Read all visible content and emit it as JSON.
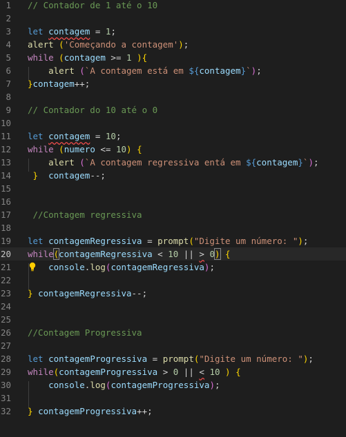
{
  "editor": {
    "current_line": 20,
    "lines": [
      {
        "n": "1",
        "tokens": [
          {
            "t": "// Contador de 1 até o 10",
            "c": "comment"
          }
        ]
      },
      {
        "n": "2",
        "tokens": []
      },
      {
        "n": "3",
        "tokens": [
          {
            "t": "let ",
            "c": "kw"
          },
          {
            "t": "contagem",
            "c": "var squig"
          },
          {
            "t": " = ",
            "c": "punc"
          },
          {
            "t": "1",
            "c": "num"
          },
          {
            "t": ";",
            "c": "punc"
          }
        ]
      },
      {
        "n": "4",
        "tokens": [
          {
            "t": "alert ",
            "c": "fn"
          },
          {
            "t": "(",
            "c": "br1"
          },
          {
            "t": "'Começando a contagem'",
            "c": "str"
          },
          {
            "t": ")",
            "c": "br1"
          },
          {
            "t": ";",
            "c": "punc"
          }
        ]
      },
      {
        "n": "5",
        "tokens": [
          {
            "t": "while ",
            "c": "ctrl"
          },
          {
            "t": "(",
            "c": "br1"
          },
          {
            "t": "contagem",
            "c": "var"
          },
          {
            "t": " >= ",
            "c": "punc"
          },
          {
            "t": "1 ",
            "c": "num"
          },
          {
            "t": ")",
            "c": "br1"
          },
          {
            "t": "{",
            "c": "br1"
          }
        ]
      },
      {
        "n": "6",
        "tokens": [
          {
            "t": "    alert ",
            "c": "fn"
          },
          {
            "t": "(",
            "c": "br2"
          },
          {
            "t": "`A contagem está em ",
            "c": "str"
          },
          {
            "t": "${",
            "c": "tpl"
          },
          {
            "t": "contagem",
            "c": "var"
          },
          {
            "t": "}",
            "c": "tpl"
          },
          {
            "t": "`",
            "c": "str"
          },
          {
            "t": ")",
            "c": "br2"
          },
          {
            "t": ";",
            "c": "punc"
          }
        ]
      },
      {
        "n": "7",
        "tokens": [
          {
            "t": "}",
            "c": "br1"
          },
          {
            "t": "contagem",
            "c": "var"
          },
          {
            "t": "++;",
            "c": "punc"
          }
        ]
      },
      {
        "n": "8",
        "tokens": []
      },
      {
        "n": "9",
        "tokens": [
          {
            "t": "// Contador do 10 até o 0",
            "c": "comment"
          }
        ]
      },
      {
        "n": "10",
        "tokens": []
      },
      {
        "n": "11",
        "tokens": [
          {
            "t": "let ",
            "c": "kw"
          },
          {
            "t": "contagem",
            "c": "var squig"
          },
          {
            "t": " = ",
            "c": "punc"
          },
          {
            "t": "10",
            "c": "num"
          },
          {
            "t": ";",
            "c": "punc"
          }
        ]
      },
      {
        "n": "12",
        "tokens": [
          {
            "t": "while ",
            "c": "ctrl"
          },
          {
            "t": "(",
            "c": "br1"
          },
          {
            "t": "numero",
            "c": "var"
          },
          {
            "t": " <= ",
            "c": "punc"
          },
          {
            "t": "10",
            "c": "num"
          },
          {
            "t": ") ",
            "c": "br1"
          },
          {
            "t": "{",
            "c": "br1"
          }
        ]
      },
      {
        "n": "13",
        "tokens": [
          {
            "t": "    alert ",
            "c": "fn"
          },
          {
            "t": "(",
            "c": "br2"
          },
          {
            "t": "`A contagem regressiva entá em ",
            "c": "str"
          },
          {
            "t": "${",
            "c": "tpl"
          },
          {
            "t": "contagem",
            "c": "var"
          },
          {
            "t": "}",
            "c": "tpl"
          },
          {
            "t": "`",
            "c": "str"
          },
          {
            "t": ")",
            "c": "br2"
          },
          {
            "t": ";",
            "c": "punc"
          }
        ]
      },
      {
        "n": "14",
        "tokens": [
          {
            "t": " }",
            "c": "br1"
          },
          {
            "t": "  contagem",
            "c": "var"
          },
          {
            "t": "--;",
            "c": "punc"
          }
        ]
      },
      {
        "n": "15",
        "tokens": []
      },
      {
        "n": "16",
        "tokens": []
      },
      {
        "n": "17",
        "tokens": [
          {
            "t": " //Contagem regressiva",
            "c": "comment"
          }
        ]
      },
      {
        "n": "18",
        "tokens": []
      },
      {
        "n": "19",
        "tokens": [
          {
            "t": "let ",
            "c": "kw"
          },
          {
            "t": "contagemRegressiva",
            "c": "var"
          },
          {
            "t": " = ",
            "c": "punc"
          },
          {
            "t": "prompt",
            "c": "fn"
          },
          {
            "t": "(",
            "c": "br1"
          },
          {
            "t": "\"Digite um número: \"",
            "c": "str"
          },
          {
            "t": ")",
            "c": "br1"
          },
          {
            "t": ";",
            "c": "punc"
          }
        ]
      },
      {
        "n": "20",
        "tokens": [
          {
            "t": "while",
            "c": "ctrl"
          },
          {
            "t": "(",
            "c": "br1 bracket-box"
          },
          {
            "t": "contagemRegressiva",
            "c": "var"
          },
          {
            "t": " < ",
            "c": "punc"
          },
          {
            "t": "10",
            "c": "num"
          },
          {
            "t": " || ",
            "c": "punc"
          },
          {
            "t": ">",
            "c": "punc squig"
          },
          {
            "t": " ",
            "c": "punc"
          },
          {
            "t": "0",
            "c": "num"
          },
          {
            "t": ")",
            "c": "br1 bracket-box"
          },
          {
            "t": " ",
            "c": "punc"
          },
          {
            "t": "{",
            "c": "br1"
          }
        ]
      },
      {
        "n": "21",
        "tokens": [
          {
            "t": "    console",
            "c": "var"
          },
          {
            "t": ".",
            "c": "punc"
          },
          {
            "t": "log",
            "c": "fn"
          },
          {
            "t": "(",
            "c": "br2"
          },
          {
            "t": "contagemRegressiva",
            "c": "var"
          },
          {
            "t": ")",
            "c": "br2"
          },
          {
            "t": ";",
            "c": "punc"
          }
        ]
      },
      {
        "n": "22",
        "tokens": []
      },
      {
        "n": "23",
        "tokens": [
          {
            "t": "} ",
            "c": "br1"
          },
          {
            "t": "contagemRegressiva",
            "c": "var"
          },
          {
            "t": "--;",
            "c": "punc"
          }
        ]
      },
      {
        "n": "24",
        "tokens": []
      },
      {
        "n": "25",
        "tokens": []
      },
      {
        "n": "26",
        "tokens": [
          {
            "t": "//Contagem Progressiva",
            "c": "comment"
          }
        ]
      },
      {
        "n": "27",
        "tokens": []
      },
      {
        "n": "28",
        "tokens": [
          {
            "t": "let ",
            "c": "kw"
          },
          {
            "t": "contagemProgressiva",
            "c": "var"
          },
          {
            "t": " = ",
            "c": "punc"
          },
          {
            "t": "prompt",
            "c": "fn"
          },
          {
            "t": "(",
            "c": "br1"
          },
          {
            "t": "\"Digite um número: \"",
            "c": "str"
          },
          {
            "t": ")",
            "c": "br1"
          },
          {
            "t": ";",
            "c": "punc"
          }
        ]
      },
      {
        "n": "29",
        "tokens": [
          {
            "t": "while",
            "c": "ctrl"
          },
          {
            "t": "(",
            "c": "br1"
          },
          {
            "t": "contagemProgressiva",
            "c": "var"
          },
          {
            "t": " > ",
            "c": "punc"
          },
          {
            "t": "0",
            "c": "num"
          },
          {
            "t": " || ",
            "c": "punc"
          },
          {
            "t": "<",
            "c": "punc squig"
          },
          {
            "t": " ",
            "c": "punc"
          },
          {
            "t": "10",
            "c": "num"
          },
          {
            "t": " ) ",
            "c": "br1"
          },
          {
            "t": "{",
            "c": "br1"
          }
        ]
      },
      {
        "n": "30",
        "tokens": [
          {
            "t": "    console",
            "c": "var"
          },
          {
            "t": ".",
            "c": "punc"
          },
          {
            "t": "log",
            "c": "fn"
          },
          {
            "t": "(",
            "c": "br2"
          },
          {
            "t": "contagemProgressiva",
            "c": "var"
          },
          {
            "t": ")",
            "c": "br2"
          },
          {
            "t": ";",
            "c": "punc"
          }
        ]
      },
      {
        "n": "31",
        "tokens": []
      },
      {
        "n": "32",
        "tokens": [
          {
            "t": "} ",
            "c": "br1"
          },
          {
            "t": "contagemProgressiva",
            "c": "var"
          },
          {
            "t": "++;",
            "c": "punc"
          }
        ]
      }
    ],
    "lightbulb_icon": "lightbulb-icon",
    "colors": {
      "background": "#1e1e1e",
      "keyword": "#569cd6",
      "control": "#c586c0",
      "variable": "#9cdcfe",
      "function": "#dcdcaa",
      "string": "#ce9178",
      "number": "#b5cea8",
      "comment": "#6a9955"
    }
  }
}
